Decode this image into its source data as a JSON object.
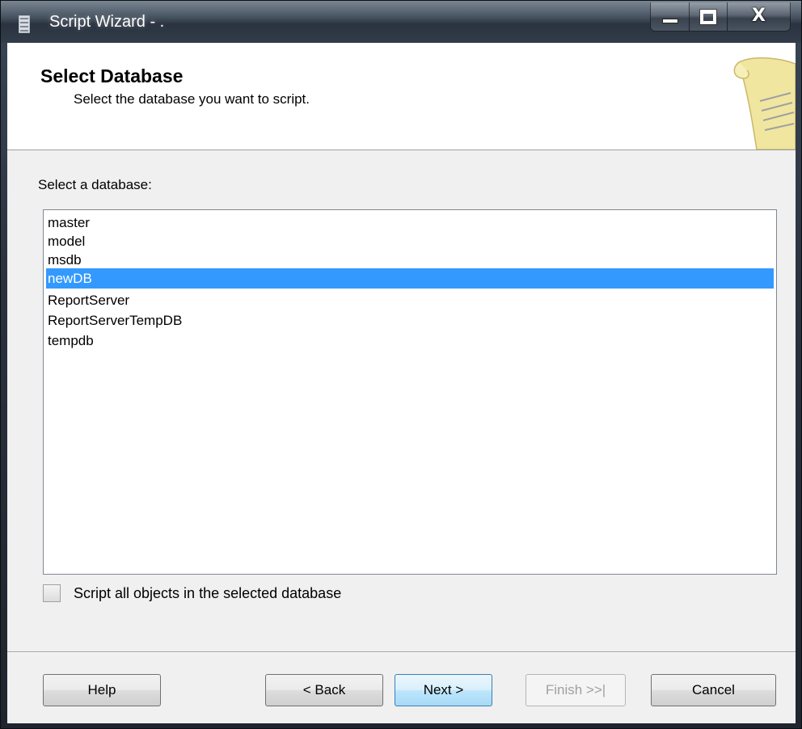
{
  "window": {
    "title": "Script Wizard - ."
  },
  "caption": {
    "close_glyph": "X"
  },
  "header": {
    "title": "Select Database",
    "subtitle": "Select the database you want to script."
  },
  "database_list": {
    "label": "Select a database:",
    "items": [
      "master",
      "model",
      "msdb",
      "newDB",
      "ReportServer",
      "ReportServerTempDB",
      "tempdb"
    ],
    "selected_item": "newDB"
  },
  "options": {
    "script_all_label": "Script all objects in the selected database",
    "script_all_checked": false
  },
  "buttons": {
    "help": "Help",
    "back": "< Back",
    "next": "Next >",
    "finish": "Finish >>|",
    "cancel": "Cancel"
  },
  "colors": {
    "selection": "#3399ff",
    "scroll_parchment": "#f0e6a0"
  }
}
